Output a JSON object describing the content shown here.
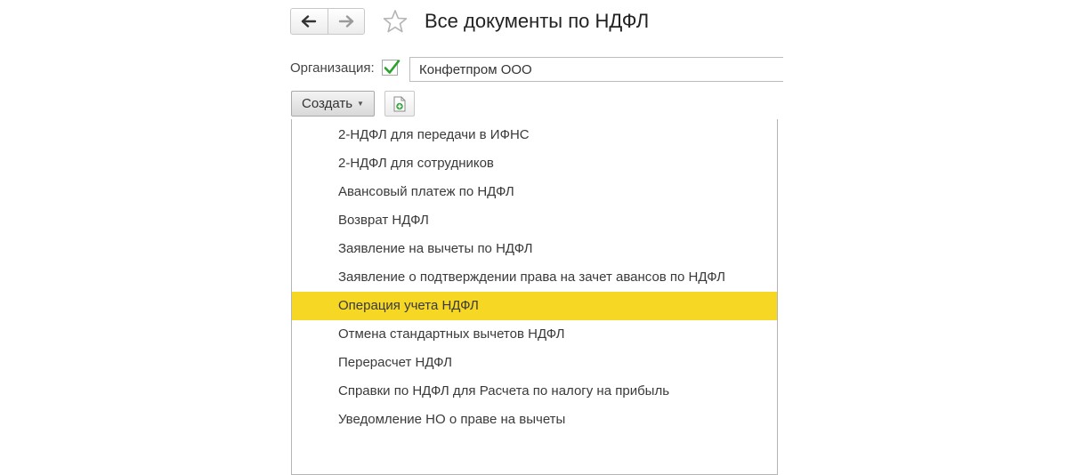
{
  "header": {
    "title": "Все документы по НДФЛ",
    "back_icon": "arrow-left-icon",
    "forward_icon": "arrow-right-icon",
    "favorite_icon": "star-icon"
  },
  "filter": {
    "organization_label": "Организация:",
    "organization_checked": true,
    "organization_value": "Конфетпром ООО"
  },
  "toolbar": {
    "create_label": "Создать",
    "create_caret": "▼",
    "doc_icon": "document-add-icon"
  },
  "menu": {
    "items": [
      "2-НДФЛ для передачи в ИФНС",
      "2-НДФЛ для сотрудников",
      "Авансовый платеж по НДФЛ",
      "Возврат НДФЛ",
      "Заявление на вычеты по НДФЛ",
      "Заявление о подтверждении права на зачет авансов по НДФЛ",
      "Операция учета НДФЛ",
      "Отмена стандартных вычетов НДФЛ",
      "Перерасчет НДФЛ",
      "Справки по НДФЛ для Расчета по налогу на прибыль",
      "Уведомление НО о праве на вычеты"
    ],
    "selected_index": 6,
    "highlight_color": "#f5d724"
  }
}
